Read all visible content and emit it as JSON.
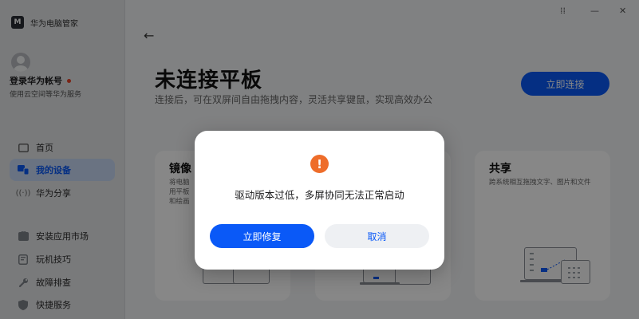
{
  "app": {
    "title": "华为电脑管家",
    "logo_text": "M"
  },
  "account": {
    "name": "登录华为帐号",
    "desc": "使用云空间等华为服务"
  },
  "sidebar": {
    "items": [
      {
        "label": "首页",
        "icon": "tablet-icon"
      },
      {
        "label": "我的设备",
        "icon": "devices-icon",
        "active": true
      },
      {
        "label": "华为分享",
        "icon": "share-wave-icon"
      },
      {
        "label": "安装应用市场",
        "icon": "store-icon"
      },
      {
        "label": "玩机技巧",
        "icon": "tips-icon"
      },
      {
        "label": "故障排查",
        "icon": "wrench-icon"
      },
      {
        "label": "快捷服务",
        "icon": "shield-icon"
      }
    ]
  },
  "window_controls": {
    "restore": "⁞⁞",
    "minimize": "—",
    "close": "✕"
  },
  "main": {
    "back": "←",
    "title": "未连接平板",
    "subtitle": "连接后，可在双屏间自由拖拽内容，灵活共享键鼠，实现高效办公",
    "connect_button": "立即连接"
  },
  "cards": [
    {
      "title": "镜像",
      "desc": "将电脑\n用平板\n和绘画"
    },
    {
      "title": "",
      "desc": ""
    },
    {
      "title": "共享",
      "desc": "跨系统相互拖拽文字、图片和文件"
    }
  ],
  "dialog": {
    "icon": "warning-icon",
    "icon_glyph": "!",
    "message": "驱动版本过低，多屏协同无法正常启动",
    "fix_button": "立即修复",
    "cancel_button": "取消"
  },
  "colors": {
    "accent": "#0a59f7",
    "warning": "#ee6d2a",
    "badge": "#e84026"
  }
}
